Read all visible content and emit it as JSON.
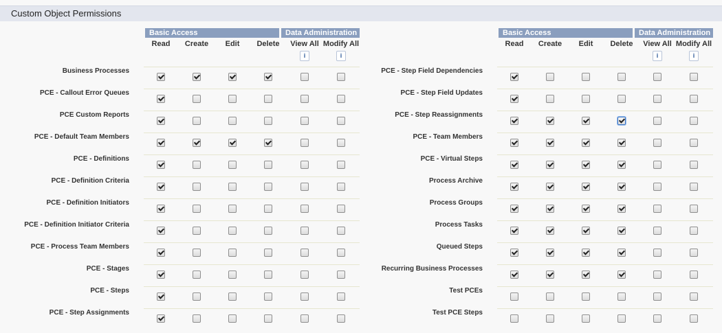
{
  "title": "Custom Object Permissions",
  "groups": {
    "basic": "Basic Access",
    "data_admin": "Data Administration"
  },
  "columns": [
    "Read",
    "Create",
    "Edit",
    "Delete",
    "View All",
    "Modify All"
  ],
  "info_glyph": "i",
  "left": {
    "rows": [
      {
        "label": "Business Processes",
        "perms": [
          1,
          1,
          1,
          1,
          0,
          0
        ]
      },
      {
        "label": "PCE - Callout Error Queues",
        "perms": [
          1,
          0,
          0,
          0,
          0,
          0
        ]
      },
      {
        "label": "PCE Custom Reports",
        "perms": [
          1,
          0,
          0,
          0,
          0,
          0
        ]
      },
      {
        "label": "PCE - Default Team Members",
        "perms": [
          1,
          1,
          1,
          1,
          0,
          0
        ]
      },
      {
        "label": "PCE - Definitions",
        "perms": [
          1,
          0,
          0,
          0,
          0,
          0
        ]
      },
      {
        "label": "PCE - Definition Criteria",
        "perms": [
          1,
          0,
          0,
          0,
          0,
          0
        ]
      },
      {
        "label": "PCE - Definition Initiators",
        "perms": [
          1,
          0,
          0,
          0,
          0,
          0
        ]
      },
      {
        "label": "PCE - Definition Initiator Criteria",
        "perms": [
          1,
          0,
          0,
          0,
          0,
          0
        ]
      },
      {
        "label": "PCE - Process Team Members",
        "perms": [
          1,
          0,
          0,
          0,
          0,
          0
        ]
      },
      {
        "label": "PCE - Stages",
        "perms": [
          1,
          0,
          0,
          0,
          0,
          0
        ]
      },
      {
        "label": "PCE - Steps",
        "perms": [
          1,
          0,
          0,
          0,
          0,
          0
        ]
      },
      {
        "label": "PCE - Step Assignments",
        "perms": [
          1,
          0,
          0,
          0,
          0,
          0
        ]
      }
    ]
  },
  "right": {
    "rows": [
      {
        "label": "PCE - Step Field Dependencies",
        "perms": [
          1,
          0,
          0,
          0,
          0,
          0
        ]
      },
      {
        "label": "PCE - Step Field Updates",
        "perms": [
          1,
          0,
          0,
          0,
          0,
          0
        ]
      },
      {
        "label": "PCE - Step Reassignments",
        "perms": [
          1,
          1,
          1,
          1,
          0,
          0
        ],
        "focused": 3
      },
      {
        "label": "PCE - Team Members",
        "perms": [
          1,
          1,
          1,
          1,
          0,
          0
        ]
      },
      {
        "label": "PCE - Virtual Steps",
        "perms": [
          1,
          1,
          1,
          1,
          0,
          0
        ]
      },
      {
        "label": "Process Archive",
        "perms": [
          1,
          1,
          1,
          1,
          0,
          0
        ]
      },
      {
        "label": "Process Groups",
        "perms": [
          1,
          1,
          1,
          1,
          0,
          0
        ]
      },
      {
        "label": "Process Tasks",
        "perms": [
          1,
          1,
          1,
          1,
          0,
          0
        ]
      },
      {
        "label": "Queued Steps",
        "perms": [
          1,
          1,
          1,
          1,
          0,
          0
        ]
      },
      {
        "label": "Recurring Business Processes",
        "perms": [
          1,
          1,
          1,
          1,
          0,
          0
        ]
      },
      {
        "label": "Test PCEs",
        "perms": [
          0,
          0,
          0,
          0,
          0,
          0
        ]
      },
      {
        "label": "Test PCE Steps",
        "perms": [
          0,
          0,
          0,
          0,
          0,
          0
        ]
      }
    ]
  }
}
